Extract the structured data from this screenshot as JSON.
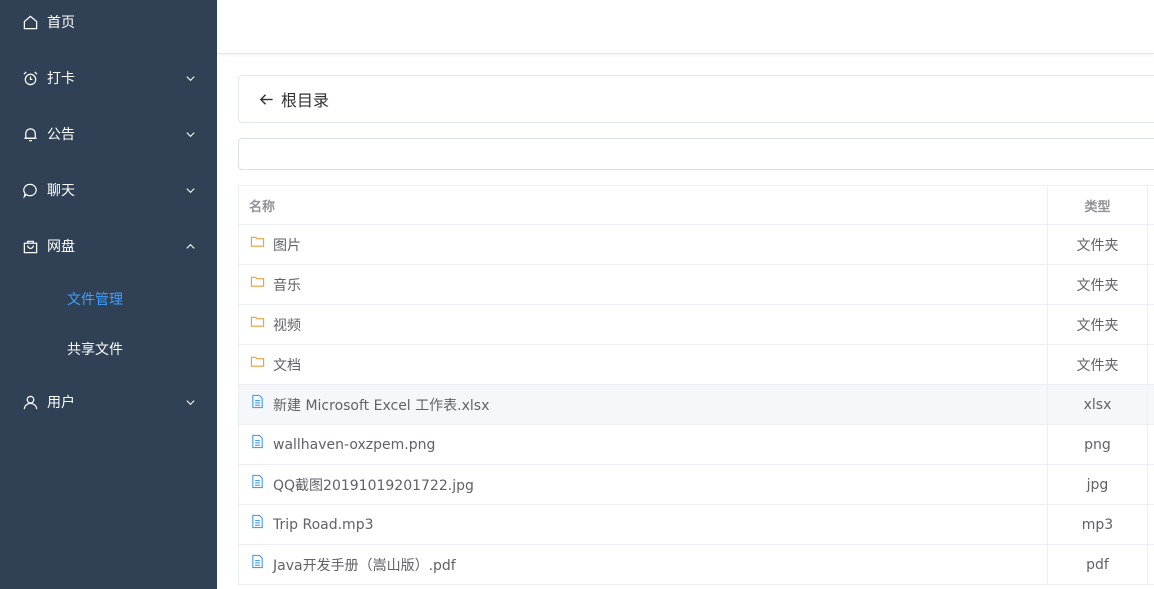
{
  "sidebar": {
    "items": [
      {
        "label": "首页",
        "icon": "home-icon"
      },
      {
        "label": "打卡",
        "icon": "alarm-clock-icon"
      },
      {
        "label": "公告",
        "icon": "bell-icon"
      },
      {
        "label": "聊天",
        "icon": "chat-bubble-icon"
      },
      {
        "label": "网盘",
        "icon": "shopping-bag-icon"
      },
      {
        "label": "用户",
        "icon": "user-icon"
      }
    ],
    "submenu": [
      {
        "label": "文件管理",
        "active": true
      },
      {
        "label": "共享文件",
        "active": false
      }
    ],
    "active_color": "#409eff",
    "background": "#304156"
  },
  "breadcrumb": {
    "label": "根目录"
  },
  "path_input": {
    "value": "",
    "placeholder": ""
  },
  "table": {
    "headers": {
      "name": "名称",
      "type": "类型"
    },
    "rows": [
      {
        "name": "图片",
        "type": "文件夹",
        "kind": "folder"
      },
      {
        "name": "音乐",
        "type": "文件夹",
        "kind": "folder"
      },
      {
        "name": "视频",
        "type": "文件夹",
        "kind": "folder"
      },
      {
        "name": "文档",
        "type": "文件夹",
        "kind": "folder"
      },
      {
        "name": "新建 Microsoft Excel 工作表.xlsx",
        "type": "xlsx",
        "kind": "file"
      },
      {
        "name": "wallhaven-oxzpem.png",
        "type": "png",
        "kind": "file"
      },
      {
        "name": "QQ截图20191019201722.jpg",
        "type": "jpg",
        "kind": "file"
      },
      {
        "name": "Trip Road.mp3",
        "type": "mp3",
        "kind": "file"
      },
      {
        "name": "Java开发手册（嵩山版）.pdf",
        "type": "pdf",
        "kind": "file"
      }
    ]
  }
}
